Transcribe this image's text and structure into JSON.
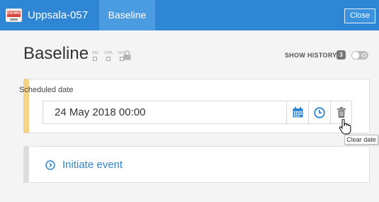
{
  "header": {
    "demo_badge": "DEMO",
    "site_name": "Uppsala-057",
    "event_tab": "Baseline",
    "close_label": "Close",
    "accent_color": "#2e86d4"
  },
  "event": {
    "title": "Baseline",
    "flags": [
      {
        "label": "DM"
      },
      {
        "label": "CRA"
      },
      {
        "label": "SDV"
      }
    ],
    "lock_icon": "lock-icon",
    "show_history_label": "SHOW HISTORY",
    "history_count": "3"
  },
  "date_field": {
    "label": "Scheduled date",
    "value": "24 May 2018 00:00",
    "buttons": [
      {
        "icon": "calendar-icon"
      },
      {
        "icon": "clock-icon"
      },
      {
        "icon": "trash-icon"
      }
    ],
    "tooltip": "Clear date"
  },
  "initiate": {
    "label": "Initiate event",
    "icon": "play-circle-icon"
  }
}
